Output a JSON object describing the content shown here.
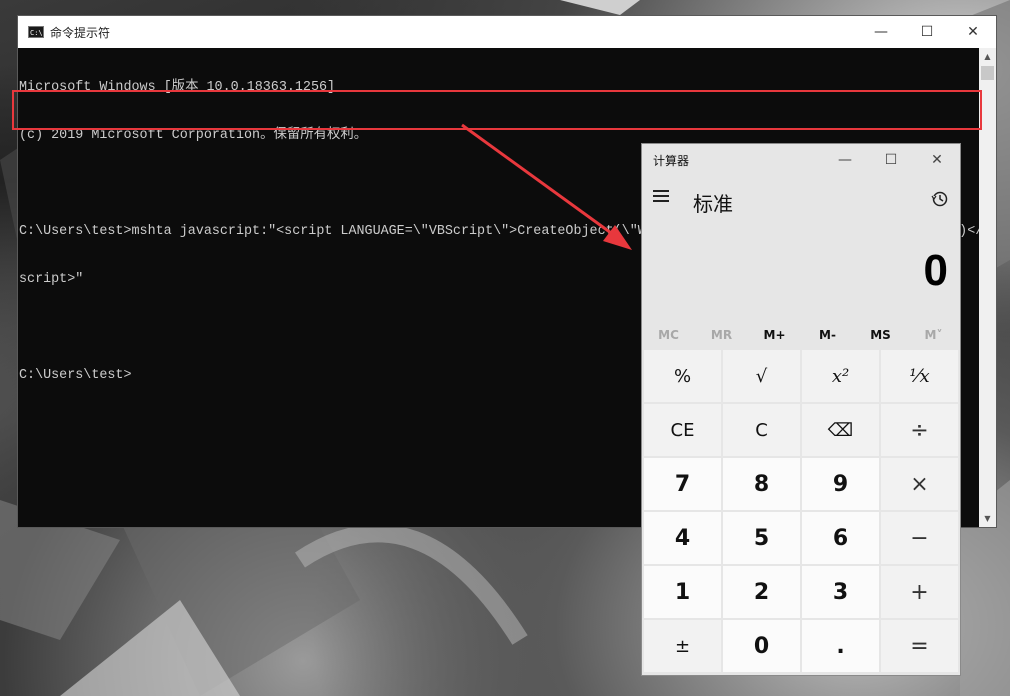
{
  "cmd": {
    "title": "命令提示符",
    "lines": [
      "Microsoft Windows [版本 10.0.18363.1256]",
      "(c) 2019 Microsoft Corporation。保留所有权利。",
      "",
      "C:\\Users\\test>mshta javascript:\"<script LANGUAGE=\\\"VBScript\\\">CreateObject(\\\"WScript.Shell\\\").run(\\\"calc\\\")\\r\\nclose()</",
      "script>\"",
      "",
      "C:\\Users\\test>"
    ],
    "window_buttons": {
      "minimize": "—",
      "maximize": "☐",
      "close": "✕"
    }
  },
  "calculator": {
    "title": "计算器",
    "mode": "标准",
    "display": "0",
    "window_buttons": {
      "minimize": "—",
      "maximize": "☐",
      "close": "✕"
    },
    "memory": [
      {
        "label": "MC",
        "enabled": false
      },
      {
        "label": "MR",
        "enabled": false
      },
      {
        "label": "M+",
        "enabled": true
      },
      {
        "label": "M-",
        "enabled": true
      },
      {
        "label": "MS",
        "enabled": true
      },
      {
        "label": "M˅",
        "enabled": false
      }
    ],
    "keys": [
      {
        "label": "%",
        "kind": "fn",
        "name": "percent-key"
      },
      {
        "label": "√",
        "kind": "fn",
        "name": "sqrt-key"
      },
      {
        "label": "x²",
        "kind": "fn",
        "name": "square-key"
      },
      {
        "label": "¹⁄x",
        "kind": "fn",
        "name": "reciprocal-key"
      },
      {
        "label": "CE",
        "kind": "fn",
        "name": "clear-entry-key"
      },
      {
        "label": "C",
        "kind": "fn",
        "name": "clear-key"
      },
      {
        "label": "⌫",
        "kind": "fn",
        "name": "backspace-key"
      },
      {
        "label": "÷",
        "kind": "op",
        "name": "divide-key"
      },
      {
        "label": "7",
        "kind": "num",
        "name": "digit-7-key"
      },
      {
        "label": "8",
        "kind": "num",
        "name": "digit-8-key"
      },
      {
        "label": "9",
        "kind": "num",
        "name": "digit-9-key"
      },
      {
        "label": "×",
        "kind": "op",
        "name": "multiply-key"
      },
      {
        "label": "4",
        "kind": "num",
        "name": "digit-4-key"
      },
      {
        "label": "5",
        "kind": "num",
        "name": "digit-5-key"
      },
      {
        "label": "6",
        "kind": "num",
        "name": "digit-6-key"
      },
      {
        "label": "−",
        "kind": "op",
        "name": "subtract-key"
      },
      {
        "label": "1",
        "kind": "num",
        "name": "digit-1-key"
      },
      {
        "label": "2",
        "kind": "num",
        "name": "digit-2-key"
      },
      {
        "label": "3",
        "kind": "num",
        "name": "digit-3-key"
      },
      {
        "label": "+",
        "kind": "op",
        "name": "add-key"
      },
      {
        "label": "±",
        "kind": "fn",
        "name": "negate-key"
      },
      {
        "label": "0",
        "kind": "num",
        "name": "digit-0-key"
      },
      {
        "label": ".",
        "kind": "num",
        "name": "decimal-key"
      },
      {
        "label": "=",
        "kind": "op",
        "name": "equals-key"
      }
    ]
  },
  "annotation": {
    "highlight_color": "#e8383d",
    "arrow_color": "#e8383d"
  }
}
